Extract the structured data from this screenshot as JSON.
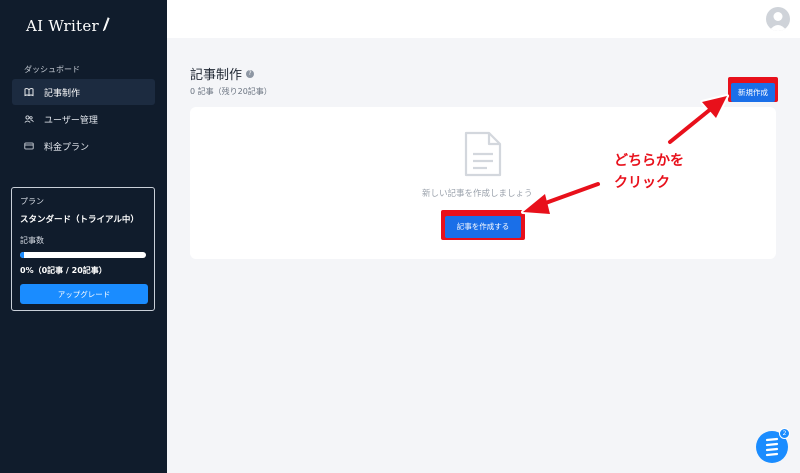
{
  "sidebar": {
    "logo": "AI Writer",
    "section_label": "ダッシュボード",
    "items": [
      {
        "label": "記事制作",
        "active": true,
        "icon": "book-icon"
      },
      {
        "label": "ユーザー管理",
        "active": false,
        "icon": "users-icon"
      },
      {
        "label": "料金プラン",
        "active": false,
        "icon": "card-icon"
      }
    ],
    "plan": {
      "label": "プラン",
      "name": "スタンダード（トライアル中）",
      "count_label": "記事数",
      "usage_fraction": 0.03,
      "usage_text": "0%（0記事 / 20記事）",
      "upgrade_label": "アップグレード"
    }
  },
  "main": {
    "title": "記事制作",
    "subtitle": "0 記事（残り20記事）",
    "new_button": "新規作成",
    "empty_text": "新しい記事を作成しましょう",
    "create_button": "記事を作成する"
  },
  "annotation": {
    "line1": "どちらかを",
    "line2": "クリック"
  },
  "chat": {
    "badge": "2"
  },
  "colors": {
    "sidebar_bg": "#101c2c",
    "primary": "#1a8cff",
    "highlight": "#e8101b"
  }
}
